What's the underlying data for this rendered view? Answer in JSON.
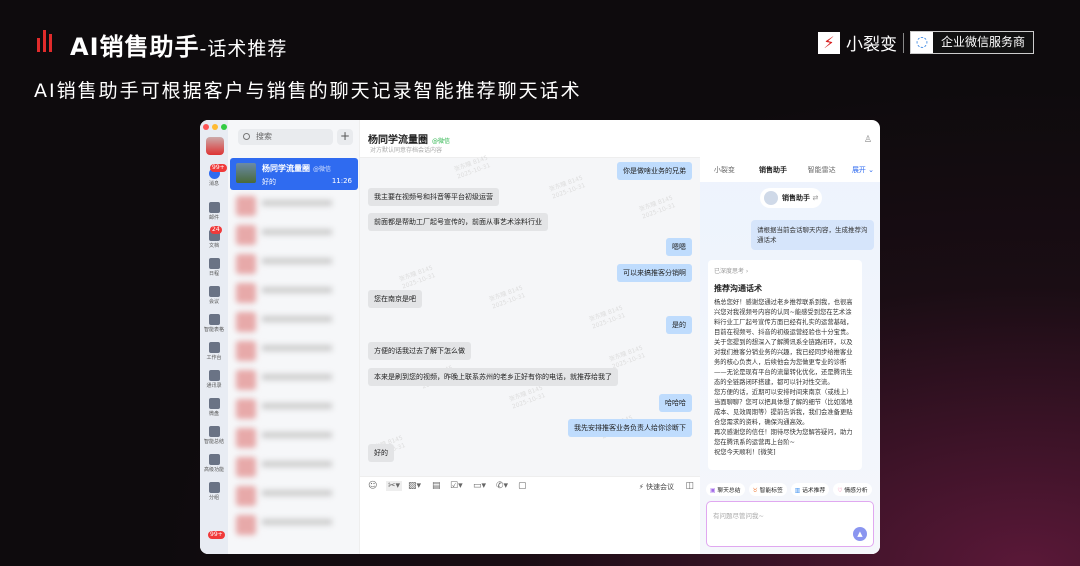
{
  "header": {
    "title": "AI销售助手",
    "title_suffix": "-话术推荐",
    "subtitle": "AI销售助手可根据客户与销售的聊天记录智能推荐聊天话术",
    "brand": "小裂变",
    "partner": "企业微信服务商"
  },
  "sidebar": {
    "items": [
      {
        "label": "消息",
        "badge": "99+"
      },
      {
        "label": "邮件"
      },
      {
        "label": "文档",
        "badge": "24"
      },
      {
        "label": "日程"
      },
      {
        "label": "会议"
      },
      {
        "label": "智能表格"
      },
      {
        "label": "工作台"
      },
      {
        "label": "通讯录"
      },
      {
        "label": "微盘"
      },
      {
        "label": "智能总结"
      },
      {
        "label": "高级功能"
      },
      {
        "label": "分组"
      }
    ],
    "bottom_badge": "99+"
  },
  "list": {
    "search_placeholder": "搜索",
    "plus": "+",
    "active": {
      "name": "杨同学流量圈",
      "tag": "@微信",
      "preview": "好的",
      "time": "11:26"
    }
  },
  "chat": {
    "title": "杨同学流量圈",
    "tag": "@微信",
    "subtitle": "对方默认同意存档会话内容",
    "watermark": {
      "name": "张东瞳 8145",
      "date": "2025-10-31"
    },
    "messages": [
      {
        "side": "r",
        "text": "你是做啥业务的兄弟"
      },
      {
        "side": "l",
        "text": "我主要在视频号和抖音等平台初级运营"
      },
      {
        "side": "l",
        "text": "前面都是帮助工厂起号宣传的，前面从事艺术涂料行业"
      },
      {
        "side": "r",
        "text": "嗯嗯"
      },
      {
        "side": "r",
        "text": "可以来搞推客分销啊"
      },
      {
        "side": "l",
        "text": "您在南京是吧"
      },
      {
        "side": "r",
        "text": "是的"
      },
      {
        "side": "l",
        "text": "方便的话我过去了解下怎么做"
      },
      {
        "side": "l",
        "text": "本来是刷到您的视频，昨晚上联系苏州的老乡正好有你的电话，就推荐给我了"
      },
      {
        "side": "r",
        "text": "哈哈哈"
      },
      {
        "side": "r",
        "text": "我先安排推客业务负责人给你诊断下"
      },
      {
        "side": "l",
        "text": "好的"
      }
    ],
    "quick_meeting": "快速会议"
  },
  "assistant": {
    "tabs": [
      "小裂变",
      "销售助手",
      "智能雷达"
    ],
    "expand": "展开 ⌄",
    "bot_name": "销售助手",
    "request": "请根据当前会话聊天内容，生成推荐沟通话术",
    "thinking": "已深度思考 ›",
    "card_title": "推荐沟通话术",
    "paragraphs": [
      "杨总您好！感谢您通过老乡推荐联系到我，也很高兴您对我视频号内容的认同~能感受到您在艺术涂料行业工厂起号宣传方面已经有扎实的运营基础，目前在视频号、抖音的初级运营经验也十分宝贵。",
      "关于您提到的想深入了解腾讯系全链路闭环，以及对我们推客分销业务的兴趣，我已经同步给推客业务的核心负责人，后续他会为您做更专业的诊断——无论是现有平台的流量转化优化，还是腾讯生态的全链路闭环搭建，都可以针对性交流。",
      "您方便的话，近期可以安排时间来南京（或线上）当面聊聊？您可以把具体想了解的细节（比如落地成本、见效周期等）提前告诉我，我们会准备更贴合您需求的资料，确保沟通高效。",
      "再次感谢您的信任！期待尽快为您解答疑问，助力您在腾讯系的运营再上台阶~",
      "祝您今天顺利！[微笑]"
    ],
    "chips": [
      "聊天总结",
      "智能标签",
      "话术推荐",
      "情感分析"
    ],
    "input_placeholder": "有问题尽管问我~"
  },
  "colors": {
    "accent": "#2f6bf0",
    "bubble_self": "#bfdcfd",
    "bubble_other": "#e3e4e6",
    "brand_red": "#e02b2b"
  }
}
